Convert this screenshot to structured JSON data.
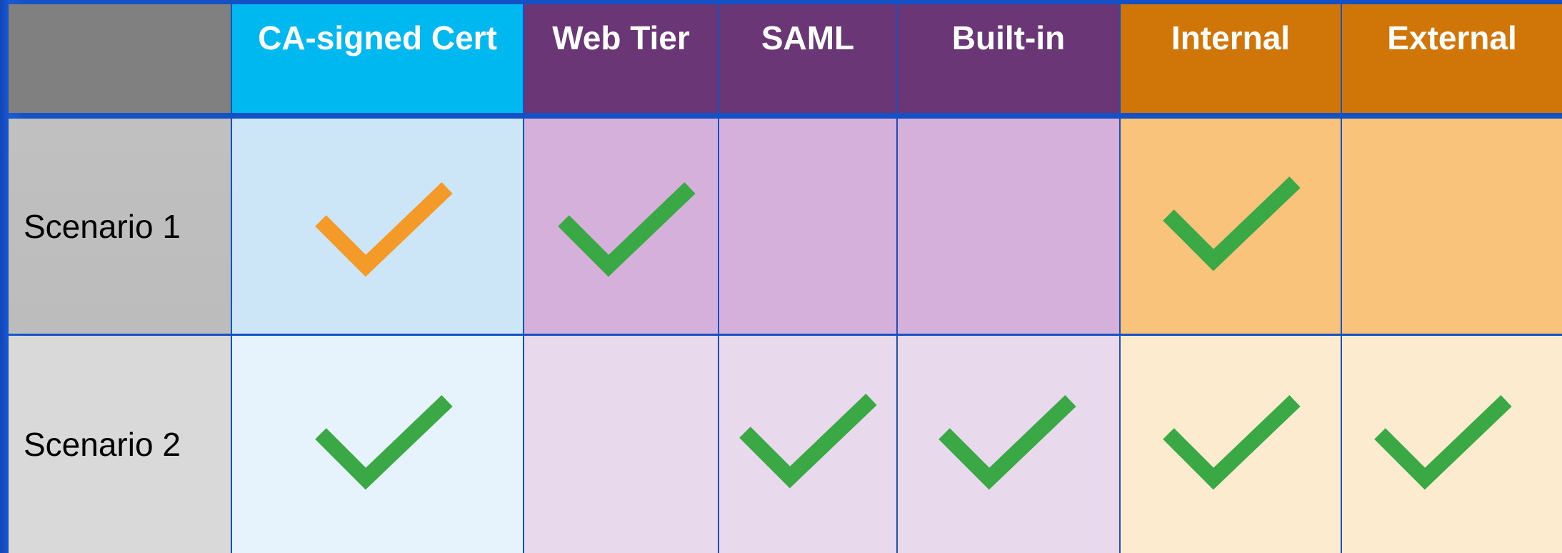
{
  "columns": [
    {
      "key": "row-header",
      "label": ""
    },
    {
      "key": "ca-signed-cert",
      "label": "CA-signed Cert"
    },
    {
      "key": "web-tier",
      "label": "Web Tier"
    },
    {
      "key": "saml",
      "label": "SAML"
    },
    {
      "key": "built-in",
      "label": "Built-in"
    },
    {
      "key": "internal",
      "label": "Internal"
    },
    {
      "key": "external",
      "label": "External"
    }
  ],
  "rows": [
    {
      "label": "Scenario 1",
      "checks": [
        "orange",
        "green",
        null,
        null,
        "green",
        null
      ]
    },
    {
      "label": "Scenario 2",
      "checks": [
        "green",
        null,
        "green",
        "green",
        "green",
        "green"
      ]
    }
  ],
  "colors": {
    "background": "#1351c4",
    "header_gray": "#808080",
    "header_cyan": "#00b8f0",
    "header_purple": "#6a3676",
    "header_orange": "#d07608",
    "row1_gray": "#bdbdbd",
    "row1_cyan": "#cce6f8",
    "row1_purple": "#d4b0db",
    "row1_orange": "#f9c37c",
    "row2_gray": "#d9d9d9",
    "row2_cyan": "#e6f3fc",
    "row2_purple": "#e9d9ec",
    "row2_orange": "#fdebd0",
    "check_green": "#39a845",
    "check_orange": "#f39a28"
  }
}
